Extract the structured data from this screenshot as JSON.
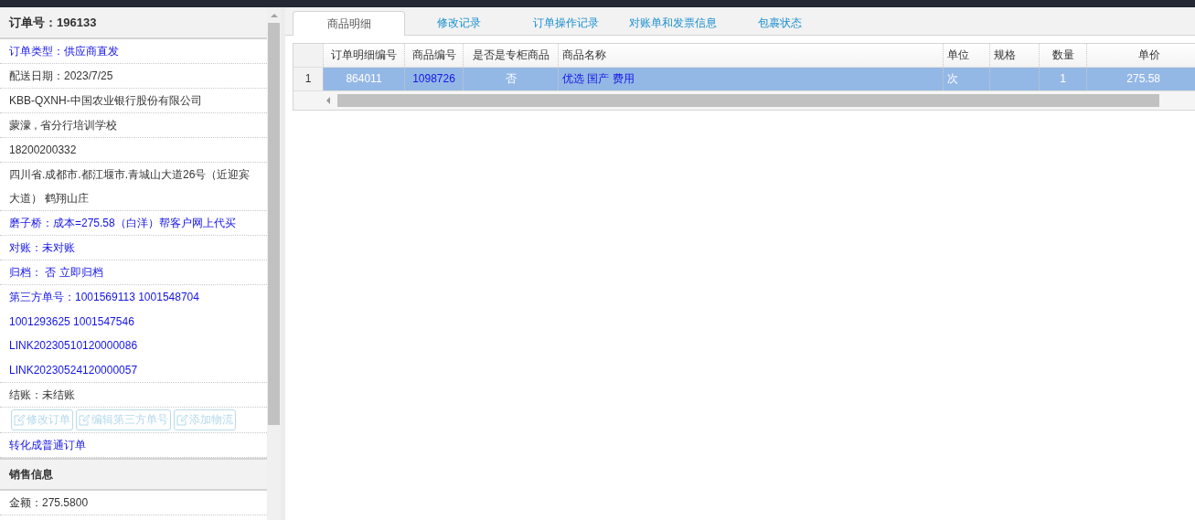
{
  "order_panel": {
    "title": "订单号：196133",
    "rows": [
      {
        "kind": "link",
        "lines": [
          "订单类型：供应商直发"
        ]
      },
      {
        "kind": "text",
        "lines": [
          "配送日期：2023/7/25"
        ]
      },
      {
        "kind": "text",
        "lines": [
          "KBB-QXNH-中国农业银行股份有限公司"
        ]
      },
      {
        "kind": "text",
        "lines": [
          "蒙濛 , 省分行培训学校"
        ]
      },
      {
        "kind": "text",
        "lines": [
          "18200200332"
        ]
      },
      {
        "kind": "text",
        "lines": [
          "四川省.成都市.都江堰市.青城山大道26号（近迎宾大道） 鹤翔山庄"
        ]
      },
      {
        "kind": "link",
        "lines": [
          "磨子桥：成本=275.58（白洋）帮客户网上代买"
        ]
      },
      {
        "kind": "link",
        "lines": [
          "对账：未对账"
        ]
      },
      {
        "kind": "link",
        "lines": [
          "归档： 否 立即归档"
        ]
      },
      {
        "kind": "link",
        "lines": [
          "第三方单号：1001569113 1001548704",
          "1001293625 1001547546",
          "LINK20230510120000086",
          "LINK20230524120000057"
        ]
      },
      {
        "kind": "text",
        "lines": [
          "结账：未结账"
        ]
      },
      {
        "kind": "buttons",
        "buttons": [
          {
            "label": "修改订单",
            "disabled": true
          },
          {
            "label": "编辑第三方单号",
            "disabled": true
          },
          {
            "label": "添加物流",
            "disabled": true
          }
        ]
      },
      {
        "kind": "link",
        "lines": [
          "转化成普通订单"
        ]
      },
      {
        "kind": "section",
        "lines": [
          "销售信息"
        ]
      },
      {
        "kind": "text",
        "lines": [
          "金额：275.5800"
        ]
      }
    ]
  },
  "tabs": [
    {
      "label": "商品明细",
      "selected": true
    },
    {
      "label": "修改记录",
      "selected": false
    },
    {
      "label": "订单操作记录",
      "selected": false
    },
    {
      "label": "对账单和发票信息",
      "selected": false
    },
    {
      "label": "包裹状态",
      "selected": false
    }
  ],
  "table": {
    "columns": [
      {
        "label": "订单明细编号"
      },
      {
        "label": "商品编号"
      },
      {
        "label": "是否是专柜商品"
      },
      {
        "label": "商品名称"
      },
      {
        "label": "单位"
      },
      {
        "label": "规格"
      },
      {
        "label": "数量"
      },
      {
        "label": "单价"
      }
    ],
    "rows": [
      {
        "number": "1",
        "selected": true,
        "cells": [
          {
            "text": "864011",
            "kind": "text"
          },
          {
            "text": "1098726",
            "kind": "link"
          },
          {
            "text": "否",
            "kind": "text"
          },
          {
            "text": "优选 国产 费用",
            "kind": "link"
          },
          {
            "text": "次",
            "kind": "text"
          },
          {
            "kind": "text"
          },
          {
            "text": "1",
            "kind": "text"
          },
          {
            "text": "275.58",
            "kind": "text"
          }
        ]
      }
    ]
  }
}
